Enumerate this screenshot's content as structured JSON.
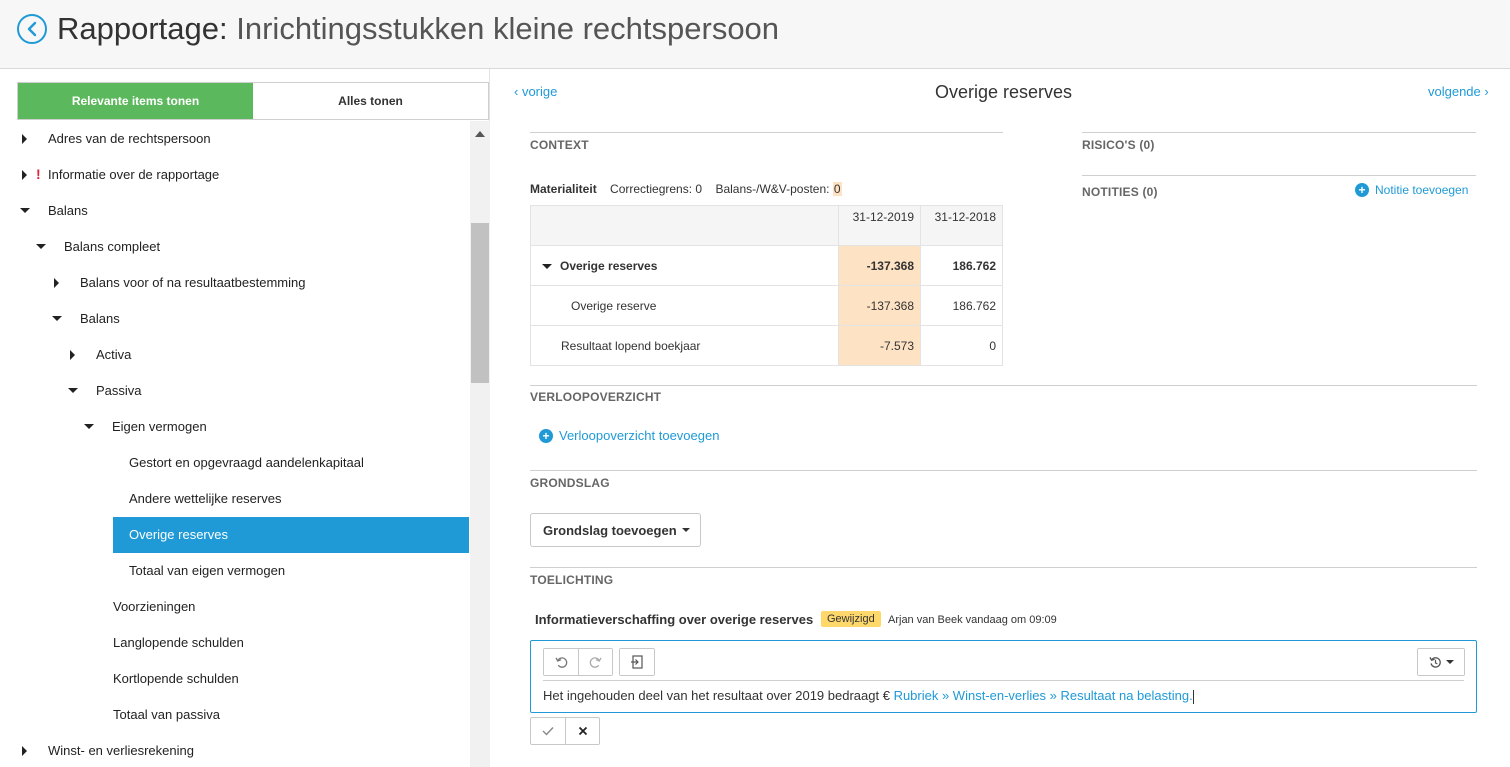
{
  "header": {
    "title_main": "Rapportage:",
    "title_sub": "Inrichtingsstukken kleine rechtspersoon"
  },
  "sidebar": {
    "toggle_relevant": "Relevante items tonen",
    "toggle_all": "Alles tonen",
    "items": [
      {
        "label": "Adres van de rechtspersoon"
      },
      {
        "label": "Informatie over de rapportage",
        "warning": "!"
      },
      {
        "label": "Balans"
      },
      {
        "label": "Balans compleet"
      },
      {
        "label": "Balans voor of na resultaatbestemming"
      },
      {
        "label": "Balans"
      },
      {
        "label": "Activa"
      },
      {
        "label": "Passiva"
      },
      {
        "label": "Eigen vermogen"
      },
      {
        "label": "Gestort en opgevraagd aandelenkapitaal"
      },
      {
        "label": "Andere wettelijke reserves"
      },
      {
        "label": "Overige reserves"
      },
      {
        "label": "Totaal van eigen vermogen"
      },
      {
        "label": "Voorzieningen"
      },
      {
        "label": "Langlopende schulden"
      },
      {
        "label": "Kortlopende schulden"
      },
      {
        "label": "Totaal van passiva"
      },
      {
        "label": "Winst- en verliesrekening"
      }
    ]
  },
  "nav": {
    "prev": "vorige",
    "next": "volgende",
    "title": "Overige reserves"
  },
  "context": {
    "label": "CONTEXT",
    "materiality_label": "Materialiteit",
    "correction_label": "Correctiegrens:",
    "correction_value": "0",
    "posts_label": "Balans-/W&V-posten:",
    "posts_value": "0",
    "table": {
      "col1": "31-12-2019",
      "col2": "31-12-2018",
      "rows": [
        {
          "label": "Overige reserves",
          "v1": "-137.368",
          "v2": "186.762"
        },
        {
          "label": "Overige reserve",
          "v1": "-137.368",
          "v2": "186.762"
        },
        {
          "label": "Resultaat lopend boekjaar",
          "v1": "-7.573",
          "v2": "0"
        }
      ]
    }
  },
  "risks": {
    "label": "RISICO'S (0)"
  },
  "notes": {
    "label": "NOTITIES (0)",
    "add": "Notitie toevoegen"
  },
  "verloop": {
    "label": "VERLOOPOVERZICHT",
    "add": "Verloopoverzicht toevoegen"
  },
  "grondslag": {
    "label": "GRONDSLAG",
    "button": "Grondslag toevoegen"
  },
  "toelichting": {
    "label": "TOELICHTING",
    "title": "Informatieverschaffing over overige reserves",
    "badge": "Gewijzigd",
    "meta": "Arjan van Beek vandaag om 09:09",
    "text_plain": "Het ingehouden deel van het resultaat over 2019 bedraagt €",
    "text_ref": "Rubriek » Winst-en-verlies » Resultaat na belasting."
  },
  "colors": {
    "accent": "#1f9ad6",
    "active_toggle": "#5cb85c",
    "highlight": "#fde2c4",
    "badge": "#ffd86b"
  }
}
